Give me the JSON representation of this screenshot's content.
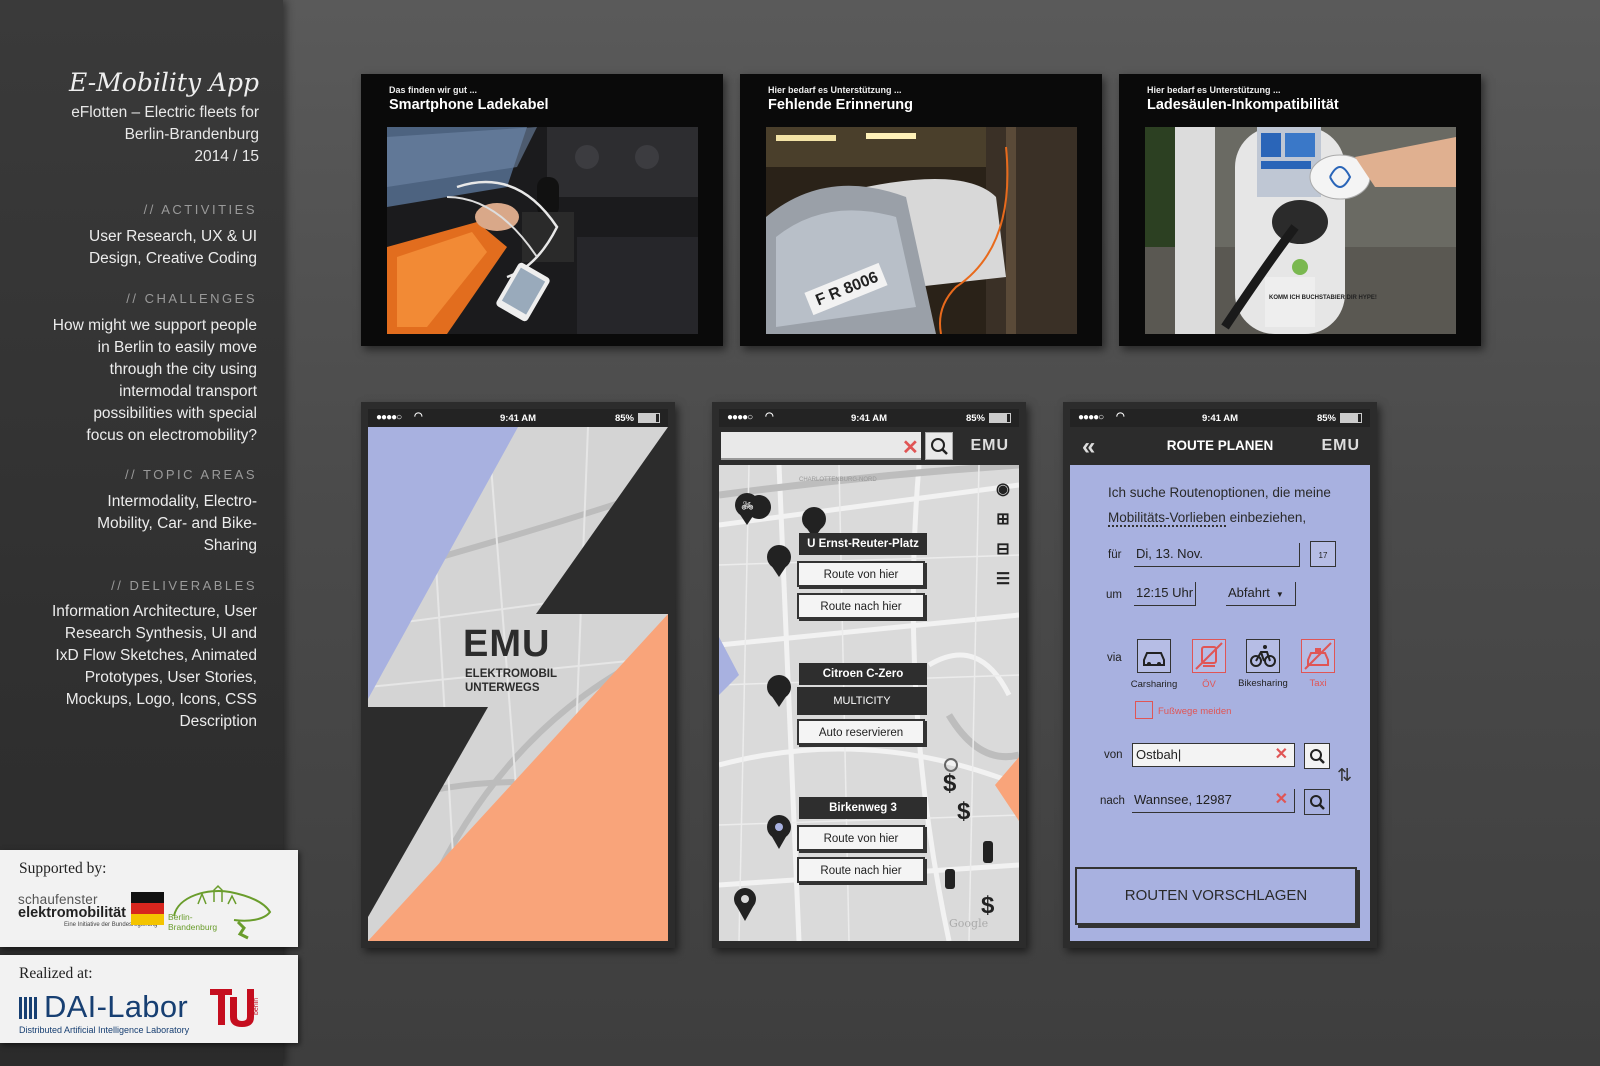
{
  "sidebar": {
    "title": "E-Mobility App",
    "subtitle_1": "eFlotten – Electric fleets for",
    "subtitle_2": "Berlin-Brandenburg",
    "subtitle_3": "2014 / 15",
    "activities_head": "// ACTIVITIES",
    "activities_body": "User Research, UX & UI Design, Creative Coding",
    "challenges_head": "// CHALLENGES",
    "challenges_body": "How might we support people in Berlin to easily move through the city using intermodal transport possibilities with special focus on electromobility?",
    "topics_head": "// TOPIC AREAS",
    "topics_body": "Intermodality, Electro-Mobility, Car- and Bike-Sharing",
    "deliverables_head": "// DELIVERABLES",
    "deliverables_body": "Information Architecture, User Research Synthesis, UI and IxD Flow Sketches, Animated Prototypes,  User Stories, Mockups, Logo, Icons, CSS Description"
  },
  "supported": {
    "label": "Supported by:",
    "schaufenster_1": "schaufenster",
    "schaufenster_2": "elektromobilität",
    "schaufenster_3": "Eine Initiative der Bundesregierung",
    "bb_1": "Berlin-",
    "bb_2": "Brandenburg"
  },
  "realized": {
    "label": "Realized at:",
    "dai_name": "DAI-Labor",
    "dai_tag": "Distributed Artificial Intelligence Laboratory",
    "tu_text": "berlin"
  },
  "photos": [
    {
      "pre": "Das finden wir gut ...",
      "title": "Smartphone Ladekabel"
    },
    {
      "pre": "Hier bedarf es Unterstützung ...",
      "title": "Fehlende Erinnerung",
      "plate": "F R 8006"
    },
    {
      "pre": "Hier bedarf es Unterstützung ...",
      "title": "Ladesäulen-Inkompatibilität",
      "sticker": "KOMM ICH BUCHSTABIER DIR HYPE!"
    }
  ],
  "status": {
    "time": "9:41 AM",
    "battery": "85%",
    "battery_level": 0.85,
    "signal": "●●●●○"
  },
  "splash": {
    "logo": "EMU",
    "tagline_1": "ELEKTROMOBIL",
    "tagline_2": "UNTERWEGS"
  },
  "map": {
    "logo": "EMU",
    "clear_icon": "✕",
    "street_top": "CHARLOTTENBURG-NORD",
    "station": "U Ernst-Reuter-Platz",
    "route_from": "Route von hier",
    "route_to": "Route nach hier",
    "car": "Citroen C-Zero",
    "operator": "MULTICITY",
    "reserve": "Auto reservieren",
    "address": "Birkenweg 3",
    "route_from_2": "Route von hier",
    "route_to_2": "Route nach hier",
    "google": "Google"
  },
  "route": {
    "back": "«",
    "title": "ROUTE PLANEN",
    "logo": "EMU",
    "intro_1": "Ich suche Routenoptionen, die meine",
    "intro_link": "Mobilitäts-Vorlieben",
    "intro_2": " einbeziehen,",
    "for_label": "für",
    "date": "Di, 13. Nov.",
    "calendar_day": "17",
    "at_label": "um",
    "time": "12:15 Uhr",
    "mode": "Abfahrt",
    "via_label": "via",
    "modes": [
      {
        "label": "Carsharing",
        "active": true
      },
      {
        "label": "ÖV",
        "active": false
      },
      {
        "label": "Bikesharing",
        "active": true
      },
      {
        "label": "Taxi",
        "active": false
      }
    ],
    "walk_label": "Fußwege meiden",
    "from_label": "von",
    "from_value": "Ostbah|",
    "to_label": "nach",
    "to_value": "Wannsee, 12987",
    "clear": "✕",
    "swap": "⇅",
    "submit": "ROUTEN VORSCHLAGEN"
  },
  "colors": {
    "accent_blue": "#a8b1e0",
    "accent_orange": "#f9a47a",
    "dark": "#2c2c2c",
    "red": "#e05555"
  }
}
